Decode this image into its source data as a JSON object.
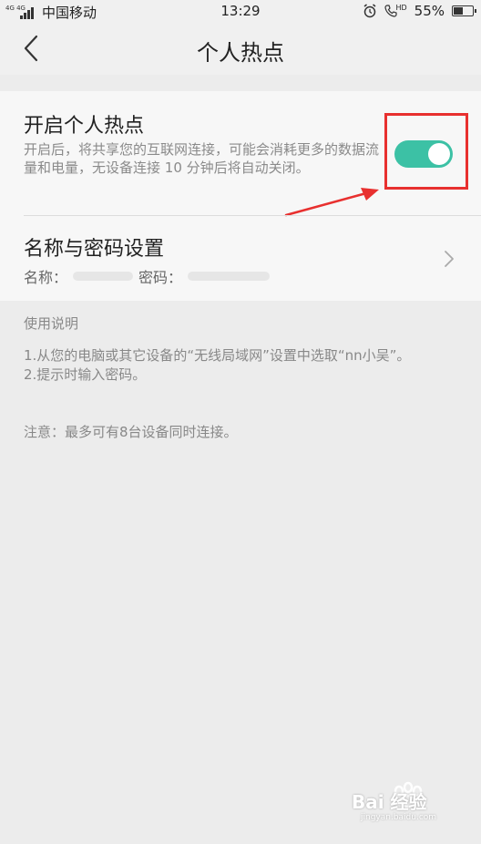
{
  "status_bar": {
    "network": "4G 4G",
    "carrier": "中国移动",
    "time": "13:29",
    "hd_label": "HD",
    "battery_percent": "55%",
    "battery_level": 0.55
  },
  "header": {
    "title": "个人热点"
  },
  "hotspot": {
    "title": "开启个人热点",
    "description": "开启后，将共享您的互联网连接，可能会消耗更多的数据流量和电量，无设备连接 10 分钟后将自动关闭。",
    "enabled": true
  },
  "name_password": {
    "title": "名称与密码设置",
    "name_label": "名称：",
    "password_label": "密码："
  },
  "instructions": {
    "heading": "使用说明",
    "step1": "1.从您的电脑或其它设备的“无线局域网”设置中选取“nn小吴”。",
    "step2": "2.提示时输入密码。",
    "note": "注意：最多可有8台设备同时连接。"
  },
  "watermark": {
    "text": "Bai 经验",
    "sub": "jingyan.baidu.com"
  },
  "colors": {
    "accent": "#3cc1a5",
    "annotation": "#e8302f"
  }
}
